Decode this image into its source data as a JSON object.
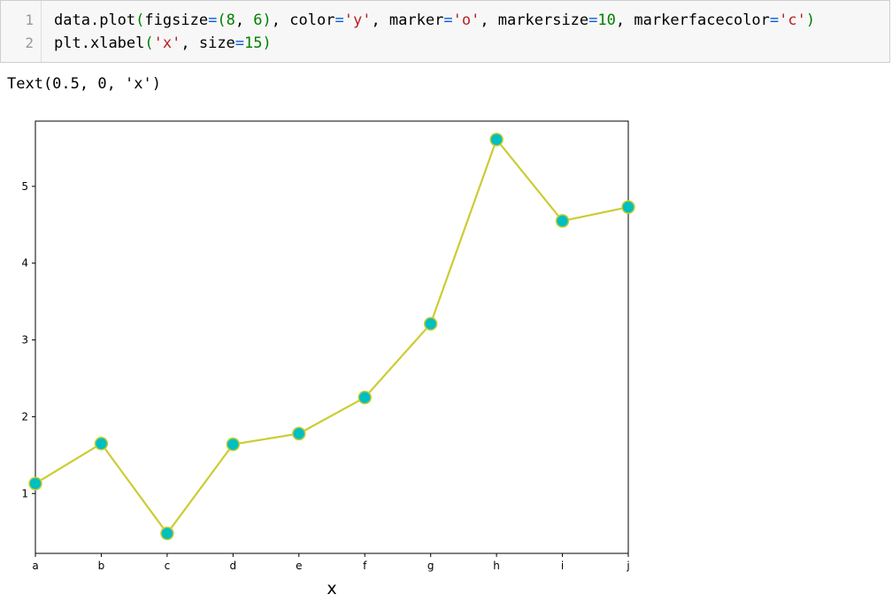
{
  "code_cell": {
    "line_numbers": [
      "1",
      "2"
    ],
    "line1": [
      {
        "t": "data",
        "c": "plain"
      },
      {
        "t": ".",
        "c": "plain"
      },
      {
        "t": "plot",
        "c": "plain"
      },
      {
        "t": "(",
        "c": "paren"
      },
      {
        "t": "figsize",
        "c": "plain"
      },
      {
        "t": "=",
        "c": "op"
      },
      {
        "t": "(",
        "c": "paren"
      },
      {
        "t": "8",
        "c": "num"
      },
      {
        "t": ", ",
        "c": "plain"
      },
      {
        "t": "6",
        "c": "num"
      },
      {
        "t": ")",
        "c": "paren"
      },
      {
        "t": ", ",
        "c": "plain"
      },
      {
        "t": "color",
        "c": "plain"
      },
      {
        "t": "=",
        "c": "op"
      },
      {
        "t": "'y'",
        "c": "str"
      },
      {
        "t": ", ",
        "c": "plain"
      },
      {
        "t": "marker",
        "c": "plain"
      },
      {
        "t": "=",
        "c": "op"
      },
      {
        "t": "'o'",
        "c": "str"
      },
      {
        "t": ", ",
        "c": "plain"
      },
      {
        "t": "markersize",
        "c": "plain"
      },
      {
        "t": "=",
        "c": "op"
      },
      {
        "t": "10",
        "c": "num"
      },
      {
        "t": ", ",
        "c": "plain"
      },
      {
        "t": "markerfacecolor",
        "c": "plain"
      },
      {
        "t": "=",
        "c": "op"
      },
      {
        "t": "'c'",
        "c": "str"
      },
      {
        "t": ")",
        "c": "paren"
      }
    ],
    "line2": [
      {
        "t": "plt",
        "c": "plain"
      },
      {
        "t": ".",
        "c": "plain"
      },
      {
        "t": "xlabel",
        "c": "plain"
      },
      {
        "t": "(",
        "c": "paren"
      },
      {
        "t": "'x'",
        "c": "str"
      },
      {
        "t": ", ",
        "c": "plain"
      },
      {
        "t": "size",
        "c": "plain"
      },
      {
        "t": "=",
        "c": "op"
      },
      {
        "t": "15",
        "c": "num"
      },
      {
        "t": ")",
        "c": "paren"
      }
    ]
  },
  "output": {
    "text": "Text(0.5, 0, 'x')"
  },
  "colors": {
    "line": "#cccc33",
    "marker_face": "#00bfbf",
    "marker_edge": "#cccc33",
    "axes": "#000000"
  },
  "chart_data": {
    "type": "line",
    "categories": [
      "a",
      "b",
      "c",
      "d",
      "e",
      "f",
      "g",
      "h",
      "i",
      "j"
    ],
    "values": [
      1.13,
      1.65,
      0.48,
      1.64,
      1.78,
      2.25,
      3.21,
      5.61,
      4.55,
      4.73
    ],
    "ylim": [
      0.22,
      5.85
    ],
    "yticks": [
      "1",
      "2",
      "3",
      "4",
      "5"
    ],
    "xlabel": "x",
    "ylabel": "",
    "title": "",
    "grid": false,
    "legend": "none"
  }
}
